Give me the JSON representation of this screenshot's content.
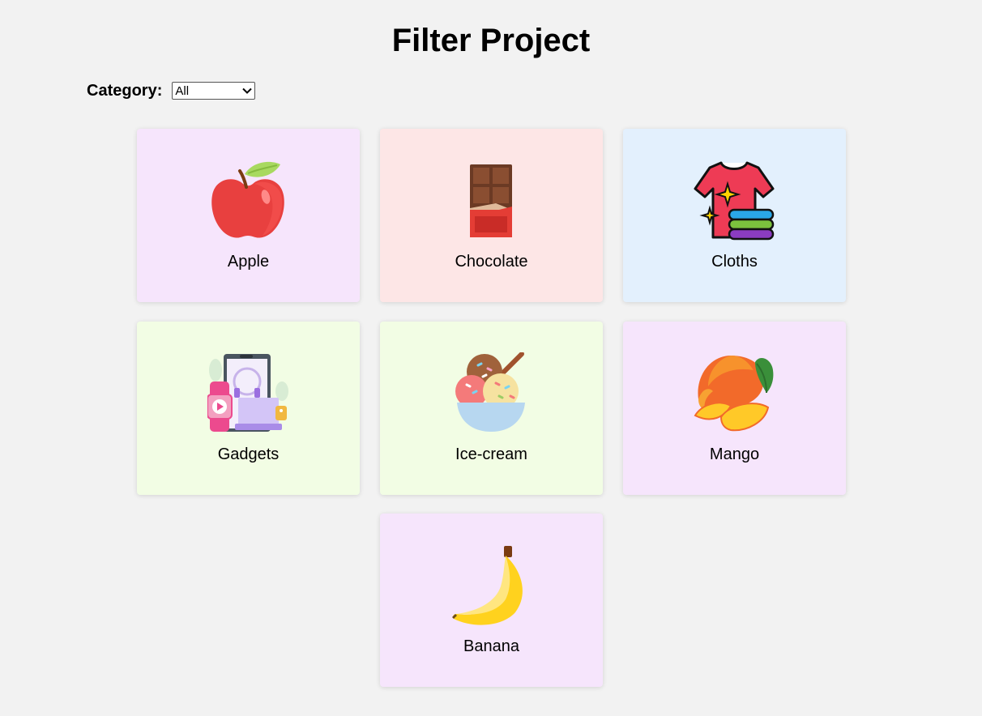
{
  "header": {
    "title": "Filter Project"
  },
  "filter": {
    "label": "Category:",
    "selected": "All"
  },
  "colors": {
    "page_bg": "#f2f2f2",
    "card_purple": "#f6e5fc",
    "card_pink": "#fde6e6",
    "card_blue": "#e3f0fd",
    "card_green": "#f2fde4"
  },
  "cards": [
    {
      "name": "Apple",
      "icon": "apple-icon",
      "bg": "#f6e5fc"
    },
    {
      "name": "Chocolate",
      "icon": "chocolate-icon",
      "bg": "#fde6e6"
    },
    {
      "name": "Cloths",
      "icon": "shirt-icon",
      "bg": "#e3f0fd"
    },
    {
      "name": "Gadgets",
      "icon": "gadgets-icon",
      "bg": "#f2fde4"
    },
    {
      "name": "Ice-cream",
      "icon": "ice-cream-icon",
      "bg": "#f2fde4"
    },
    {
      "name": "Mango",
      "icon": "mango-icon",
      "bg": "#f6e5fc"
    },
    {
      "name": "Banana",
      "icon": "banana-icon",
      "bg": "#f6e5fc"
    }
  ]
}
